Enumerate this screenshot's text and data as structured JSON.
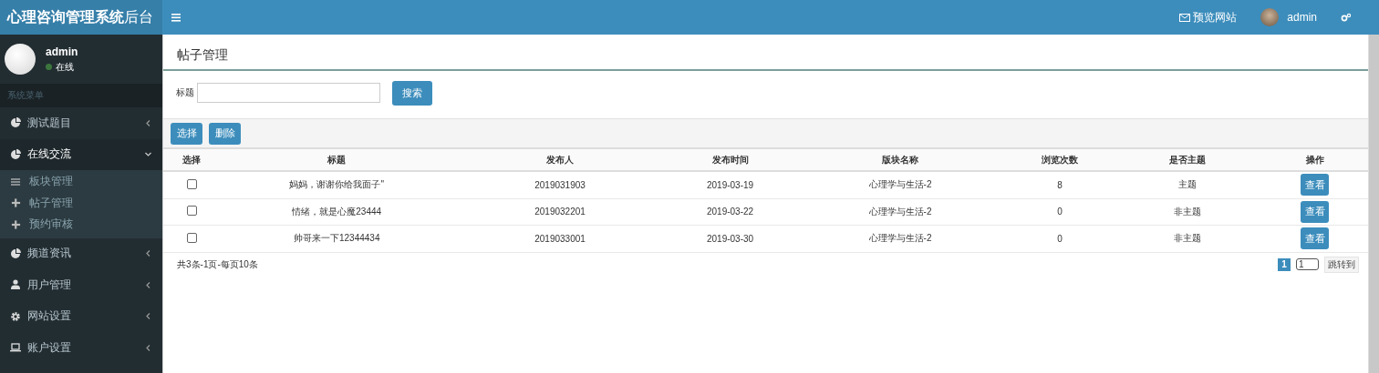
{
  "header": {
    "logo_bold": "心理咨询管理系统",
    "logo_light": "后台",
    "preview_link": "预览网站",
    "user": "admin"
  },
  "sidebar": {
    "user": {
      "name": "admin",
      "status": "在线"
    },
    "section_label": "系统菜单",
    "items": [
      {
        "label": "测试题目",
        "expanded": false
      },
      {
        "label": "在线交流",
        "expanded": true,
        "children": [
          {
            "label": "板块管理"
          },
          {
            "label": "帖子管理"
          },
          {
            "label": "预约审核"
          }
        ]
      },
      {
        "label": "频道资讯",
        "expanded": false
      },
      {
        "label": "用户管理",
        "expanded": false
      },
      {
        "label": "网站设置",
        "expanded": false
      },
      {
        "label": "账户设置",
        "expanded": false
      }
    ]
  },
  "page": {
    "title": "帖子管理",
    "search": {
      "label": "标题",
      "button": "搜索"
    },
    "actions": [
      "选择",
      "删除"
    ],
    "table": {
      "columns": [
        "选择",
        "标题",
        "发布人",
        "发布时间",
        "版块名称",
        "浏览次数",
        "是否主题",
        "操作"
      ],
      "rows": [
        {
          "cells": [
            {
              "kind": "checkbox",
              "checked": false
            },
            {
              "kind": "text",
              "text": "妈妈，谢谢你给我面子\""
            },
            {
              "kind": "text",
              "text": "2019031903"
            },
            {
              "kind": "text",
              "text": "2019-03-19"
            },
            {
              "kind": "text",
              "text": "心理学与生活-2"
            },
            {
              "kind": "text",
              "text": "8"
            },
            {
              "kind": "text",
              "text": "主题"
            },
            {
              "kind": "button",
              "text": "查看"
            }
          ]
        },
        {
          "cells": [
            {
              "kind": "checkbox",
              "checked": false
            },
            {
              "kind": "text",
              "text": "情绪，就是心魔23444"
            },
            {
              "kind": "text",
              "text": "2019032201"
            },
            {
              "kind": "text",
              "text": "2019-03-22"
            },
            {
              "kind": "text",
              "text": "心理学与生活-2"
            },
            {
              "kind": "text",
              "text": "0"
            },
            {
              "kind": "text",
              "text": "非主题"
            },
            {
              "kind": "button",
              "text": "查看"
            }
          ]
        },
        {
          "cells": [
            {
              "kind": "checkbox",
              "checked": false
            },
            {
              "kind": "text",
              "text": "帅哥来一下12344434"
            },
            {
              "kind": "text",
              "text": "2019033001"
            },
            {
              "kind": "text",
              "text": "2019-03-30"
            },
            {
              "kind": "text",
              "text": "心理学与生活-2"
            },
            {
              "kind": "text",
              "text": "0"
            },
            {
              "kind": "text",
              "text": "非主题"
            },
            {
              "kind": "button",
              "text": "查看"
            }
          ]
        }
      ]
    },
    "summary": "共3条-1页-每页10条",
    "pagination": {
      "pages": [
        {
          "label": "1",
          "selected": true
        }
      ],
      "jump_value": "1",
      "jump_button": "跳转到"
    }
  }
}
